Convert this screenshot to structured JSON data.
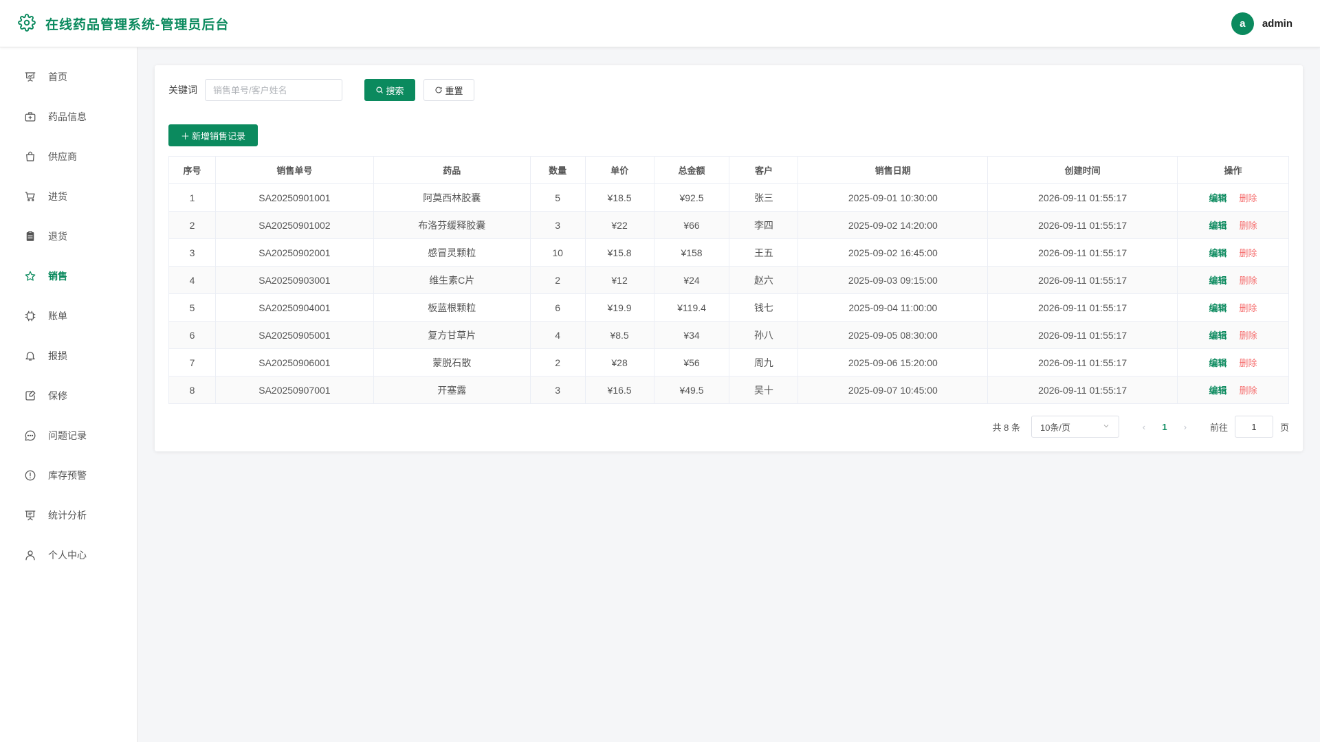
{
  "header": {
    "title": "在线药品管理系统-管理员后台",
    "avatar_letter": "a",
    "username": "admin"
  },
  "sidebar": {
    "items": [
      {
        "label": "首页",
        "icon": "dashboard-icon"
      },
      {
        "label": "药品信息",
        "icon": "medicine-box-icon"
      },
      {
        "label": "供应商",
        "icon": "bag-icon"
      },
      {
        "label": "进货",
        "icon": "cart-icon"
      },
      {
        "label": "退货",
        "icon": "clipboard-icon"
      },
      {
        "label": "销售",
        "icon": "star-icon"
      },
      {
        "label": "账单",
        "icon": "cpu-icon"
      },
      {
        "label": "报损",
        "icon": "bell-icon"
      },
      {
        "label": "保修",
        "icon": "notebook-icon"
      },
      {
        "label": "问题记录",
        "icon": "chat-icon"
      },
      {
        "label": "库存预警",
        "icon": "warning-icon"
      },
      {
        "label": "统计分析",
        "icon": "presentation-icon"
      },
      {
        "label": "个人中心",
        "icon": "user-icon"
      }
    ],
    "active_index": 5
  },
  "search": {
    "label": "关键词",
    "placeholder": "销售单号/客户姓名",
    "search_button": "搜索",
    "reset_button": "重置"
  },
  "add_button": "新增销售记录",
  "table": {
    "headers": [
      "序号",
      "销售单号",
      "药品",
      "数量",
      "单价",
      "总金额",
      "客户",
      "销售日期",
      "创建时间",
      "操作"
    ],
    "rows": [
      [
        "1",
        "SA20250901001",
        "阿莫西林胶囊",
        "5",
        "¥18.5",
        "¥92.5",
        "张三",
        "2025-09-01 10:30:00",
        "2026-09-11 01:55:17"
      ],
      [
        "2",
        "SA20250901002",
        "布洛芬缓释胶囊",
        "3",
        "¥22",
        "¥66",
        "李四",
        "2025-09-02 14:20:00",
        "2026-09-11 01:55:17"
      ],
      [
        "3",
        "SA20250902001",
        "感冒灵颗粒",
        "10",
        "¥15.8",
        "¥158",
        "王五",
        "2025-09-02 16:45:00",
        "2026-09-11 01:55:17"
      ],
      [
        "4",
        "SA20250903001",
        "维生素C片",
        "2",
        "¥12",
        "¥24",
        "赵六",
        "2025-09-03 09:15:00",
        "2026-09-11 01:55:17"
      ],
      [
        "5",
        "SA20250904001",
        "板蓝根颗粒",
        "6",
        "¥19.9",
        "¥119.4",
        "钱七",
        "2025-09-04 11:00:00",
        "2026-09-11 01:55:17"
      ],
      [
        "6",
        "SA20250905001",
        "复方甘草片",
        "4",
        "¥8.5",
        "¥34",
        "孙八",
        "2025-09-05 08:30:00",
        "2026-09-11 01:55:17"
      ],
      [
        "7",
        "SA20250906001",
        "蒙脱石散",
        "2",
        "¥28",
        "¥56",
        "周九",
        "2025-09-06 15:20:00",
        "2026-09-11 01:55:17"
      ],
      [
        "8",
        "SA20250907001",
        "开塞露",
        "3",
        "¥16.5",
        "¥49.5",
        "吴十",
        "2025-09-07 10:45:00",
        "2026-09-11 01:55:17"
      ]
    ],
    "edit_label": "编辑",
    "delete_label": "删除"
  },
  "pagination": {
    "total_text": "共 8 条",
    "page_size": "10条/页",
    "current_page": "1",
    "goto_label": "前往",
    "goto_value": "1",
    "goto_suffix": "页"
  },
  "colors": {
    "accent": "#0b8a5e",
    "danger": "#f56c6c"
  }
}
